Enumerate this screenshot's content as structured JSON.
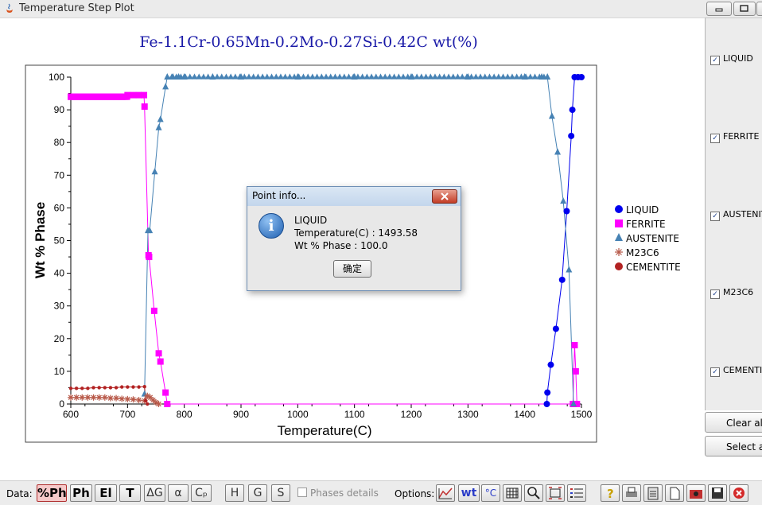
{
  "window": {
    "title": "Temperature Step Plot",
    "minimize_icon": "minimize-icon",
    "restore_icon": "restore-icon",
    "close_icon": "close-icon"
  },
  "chart_data": {
    "type": "line",
    "title": "Fe-1.1Cr-0.65Mn-0.2Mo-0.27Si-0.42C wt(%)",
    "xlabel": "Temperature(C)",
    "ylabel": "Wt % Phase",
    "xlim": [
      600,
      1500
    ],
    "ylim": [
      0,
      100
    ],
    "x_ticks": [
      600,
      700,
      800,
      900,
      1000,
      1100,
      1200,
      1300,
      1400,
      1500
    ],
    "y_ticks": [
      0,
      10,
      20,
      30,
      40,
      50,
      60,
      70,
      80,
      90,
      100
    ],
    "grid": false,
    "legend_position": "right",
    "series": [
      {
        "name": "LIQUID",
        "color": "#0000ee",
        "marker": "circle",
        "x": [
          1439,
          1440,
          1446,
          1455,
          1466,
          1474,
          1482,
          1484,
          1488,
          1494,
          1500
        ],
        "y": [
          0,
          3.5,
          12,
          23,
          38,
          59,
          82,
          90,
          100,
          100,
          100
        ]
      },
      {
        "name": "FERRITE",
        "color": "#ff00ff",
        "marker": "square",
        "x": [
          600,
          610,
          620,
          630,
          640,
          650,
          660,
          670,
          680,
          690,
          700,
          710,
          720,
          729,
          730,
          737,
          738,
          747,
          755,
          758,
          767,
          770,
          1485,
          1488,
          1490,
          1492
        ],
        "y": [
          94,
          94,
          94,
          94,
          94,
          94,
          94,
          94,
          94,
          94,
          94.5,
          94.5,
          94.5,
          94.5,
          91,
          45.5,
          45,
          28.5,
          15.5,
          13,
          3.5,
          0,
          0,
          18,
          10,
          0
        ]
      },
      {
        "name": "AUSTENITE",
        "color": "#4682b4",
        "marker": "triangle",
        "x": [
          730,
          736,
          739,
          748,
          755,
          758,
          767,
          770,
          780,
          790,
          800,
          850,
          900,
          1000,
          1100,
          1200,
          1300,
          1400,
          1430,
          1440,
          1448,
          1458,
          1468,
          1478,
          1486
        ],
        "y": [
          3,
          53,
          53,
          71,
          84.5,
          87,
          97,
          100,
          100,
          100,
          100,
          100,
          100,
          100,
          100,
          100,
          100,
          100,
          100,
          100,
          88,
          77,
          62,
          41,
          0
        ]
      },
      {
        "name": "M23C6",
        "color": "#b85a4a",
        "marker": "star",
        "x": [
          600,
          610,
          620,
          630,
          640,
          650,
          660,
          670,
          680,
          690,
          700,
          710,
          720,
          730,
          735,
          740,
          745,
          750,
          755
        ],
        "y": [
          2,
          2,
          2,
          2,
          2,
          2,
          2,
          1.8,
          1.8,
          1.6,
          1.5,
          1.4,
          1.2,
          1,
          2.5,
          2,
          1.2,
          0.5,
          0
        ]
      },
      {
        "name": "CEMENTITE",
        "color": "#b22222",
        "marker": "circle",
        "x": [
          600,
          610,
          620,
          630,
          640,
          650,
          660,
          670,
          680,
          690,
          700,
          710,
          720,
          730,
          732,
          735
        ],
        "y": [
          4.8,
          4.8,
          4.8,
          4.8,
          5,
          5,
          5,
          5,
          5,
          5.2,
          5.2,
          5.2,
          5.2,
          5.3,
          1,
          0
        ]
      }
    ]
  },
  "dialog": {
    "title": "Point info...",
    "icon": "info-icon",
    "phase": "LIQUID",
    "temperature_line": "Temperature(C) : 1493.58",
    "wt_line": "Wt % Phase : 100.0",
    "ok_label": "确定"
  },
  "side_panel": {
    "phases": [
      {
        "label": "LIQUID",
        "checked": true
      },
      {
        "label": "FERRITE",
        "checked": true
      },
      {
        "label": "AUSTENITE",
        "checked": true
      },
      {
        "label": "M23C6",
        "checked": true
      },
      {
        "label": "CEMENTITE",
        "checked": true
      }
    ],
    "clear_label": "Clear all",
    "select_label": "Select all"
  },
  "toolbar": {
    "data_label": "Data:",
    "data_buttons": [
      "%Ph",
      "Ph",
      "El",
      "T",
      "ΔG",
      "α",
      "Cₚ"
    ],
    "hgs_buttons": [
      "H",
      "G",
      "S"
    ],
    "phases_details_label": "Phases details",
    "options_label": "Options:",
    "option_buttons": [
      "wt",
      "°C"
    ]
  }
}
